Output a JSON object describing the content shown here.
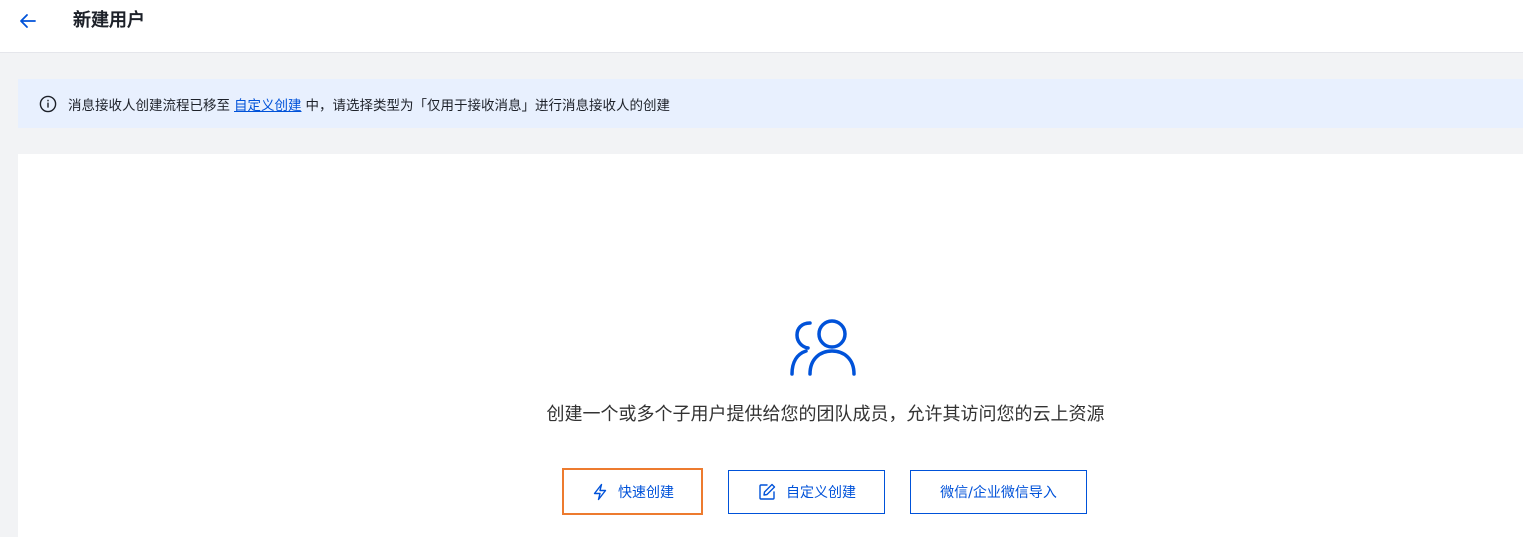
{
  "header": {
    "title": "新建用户",
    "back_icon": "arrow-left-icon"
  },
  "notice": {
    "icon": "info-icon",
    "text_before": "消息接收人创建流程已移至",
    "link_text": "自定义创建",
    "text_after": "中，请选择类型为「仅用于接收消息」进行消息接收人的创建"
  },
  "main": {
    "illustration_icon": "users-icon",
    "description": "创建一个或多个子用户提供给您的团队成员，允许其访问您的云上资源",
    "buttons": {
      "quick_create": "快速创建",
      "custom_create": "自定义创建",
      "wechat_import": "微信/企业微信导入"
    }
  },
  "colors": {
    "primary": "#0052d9",
    "highlight_border": "#ed7b2f",
    "notice_bg": "#e8f0fe",
    "page_bg": "#f2f3f5"
  }
}
